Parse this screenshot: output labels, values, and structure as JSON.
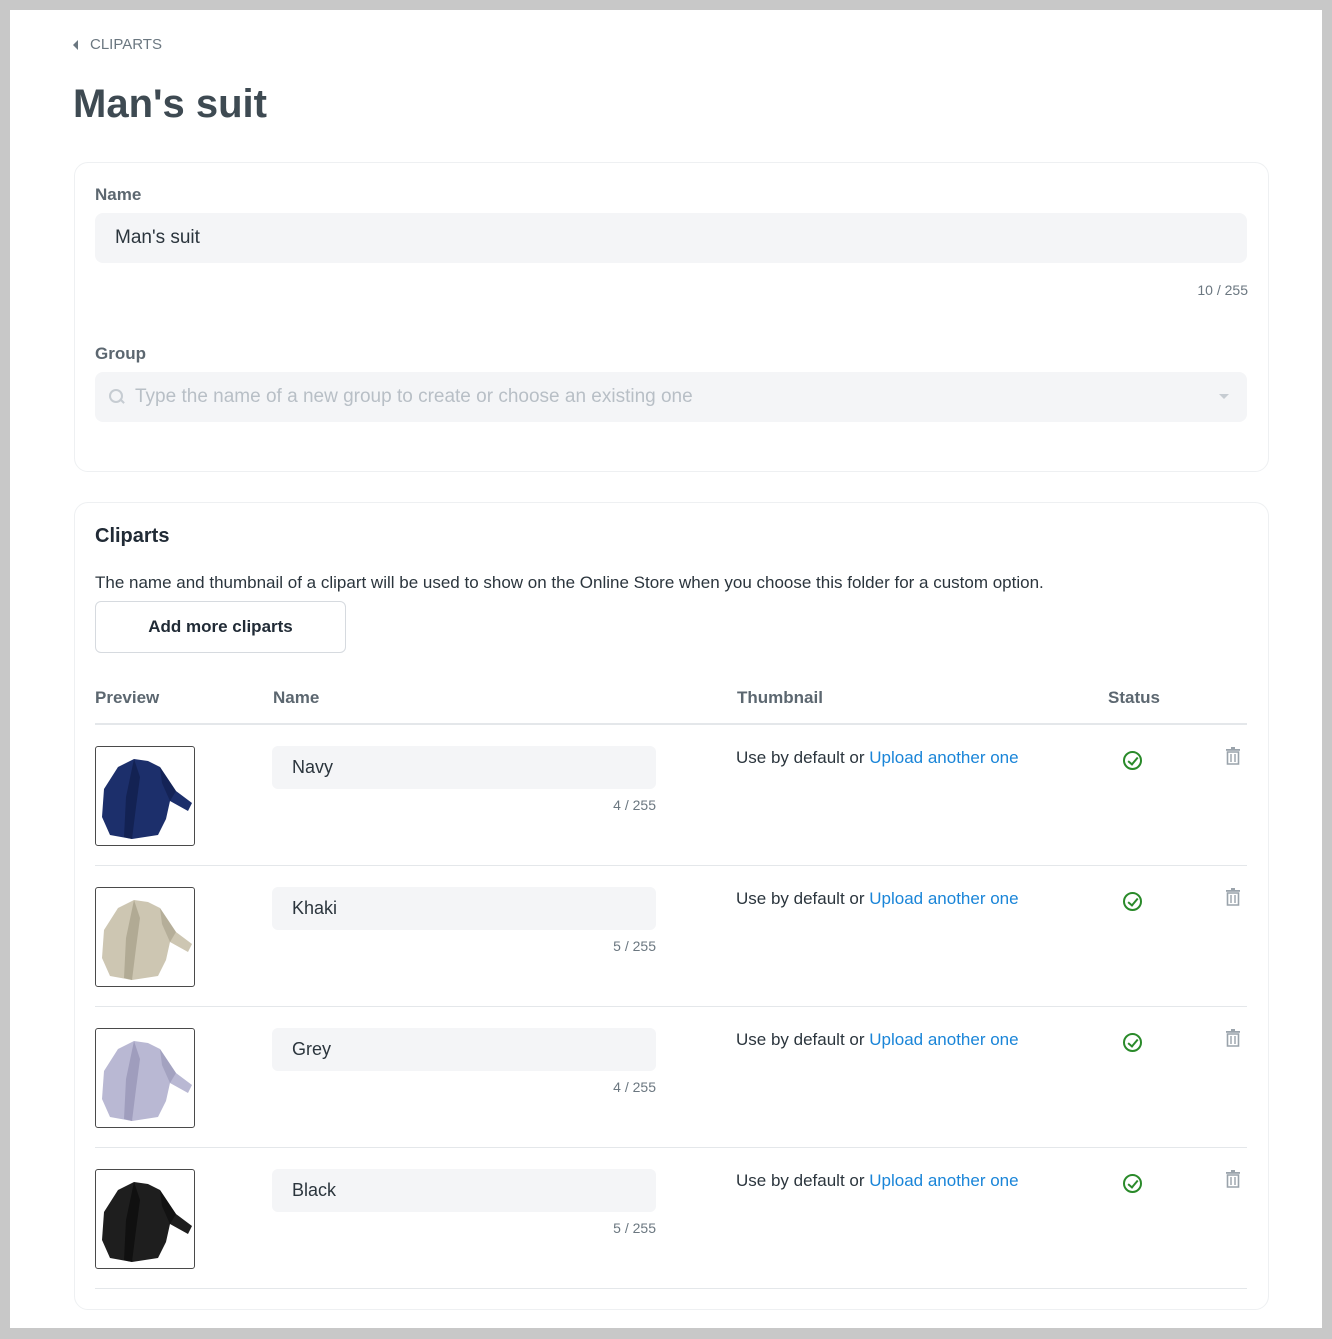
{
  "breadcrumb": {
    "label": "CLIPARTS"
  },
  "page_title": "Man's suit",
  "details": {
    "name_label": "Name",
    "name_value": "Man's suit",
    "name_counter": "10 / 255",
    "group_label": "Group",
    "group_placeholder": "Type the name of a new group to create or choose an existing one"
  },
  "cliparts": {
    "title": "Cliparts",
    "description": "The name and thumbnail of a clipart will be used to show on the Online Store when you choose this folder for a custom option.",
    "add_button": "Add more cliparts",
    "columns": {
      "preview": "Preview",
      "name": "Name",
      "thumbnail": "Thumbnail",
      "status": "Status"
    },
    "rows": [
      {
        "name": "Navy",
        "counter": "4 / 255",
        "thumb_prefix": "Use by default or",
        "thumb_link": "Upload another one",
        "color": "#1c2f6b",
        "shade": "#0f1c48"
      },
      {
        "name": "Khaki",
        "counter": "5 / 255",
        "thumb_prefix": "Use by default or",
        "thumb_link": "Upload another one",
        "color": "#cdc6b2",
        "shade": "#a59e88"
      },
      {
        "name": "Grey",
        "counter": "4 / 255",
        "thumb_prefix": "Use by default or",
        "thumb_link": "Upload another one",
        "color": "#b9b8d3",
        "shade": "#9492b4"
      },
      {
        "name": "Black",
        "counter": "5 / 255",
        "thumb_prefix": "Use by default or",
        "thumb_link": "Upload another one",
        "color": "#1e1e1e",
        "shade": "#0a0a0a"
      }
    ]
  }
}
